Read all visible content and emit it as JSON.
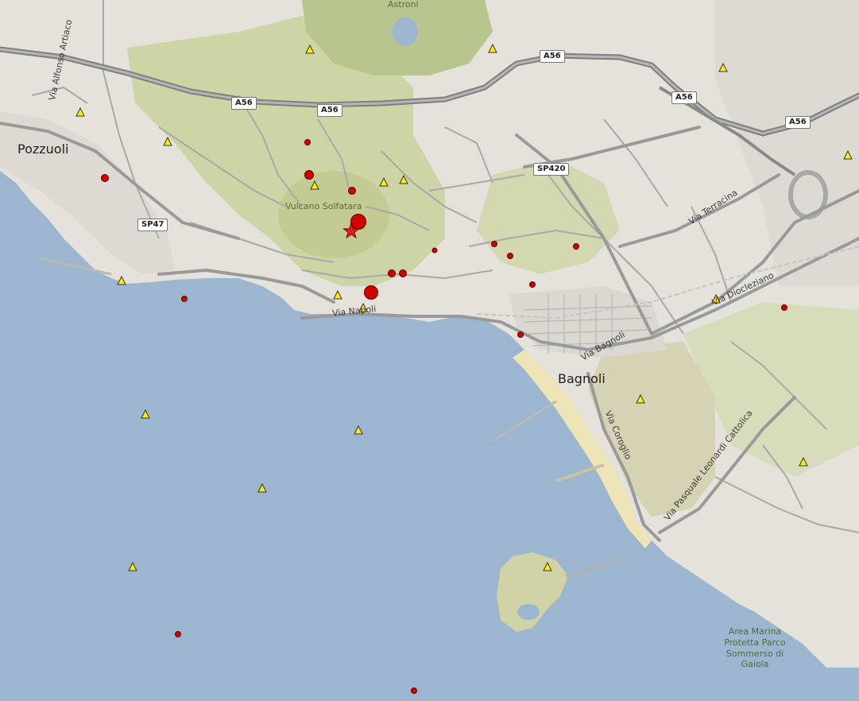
{
  "map": {
    "places": {
      "pozzuoli": "Pozzuoli",
      "bagnoli": "Bagnoli",
      "astroni": "Astroni",
      "solfatara": "Vulcano Solfatara",
      "marine_park": "Area Marina Protetta Parco Sommerso di Gaiola"
    },
    "roads": {
      "a56_1": "A56",
      "a56_2": "A56",
      "a56_3": "A56",
      "a56_4": "A56",
      "a56_5": "A56",
      "sp420": "SP420",
      "sp47": "SP47"
    },
    "streets": {
      "alfonso_artiaco": "Via Alfonso Artiaco",
      "napoli": "Via Napoli",
      "terracina": "Via Terracina",
      "diocleziano": "Via Diocleziano",
      "bagnoli": "Via Bagnoli",
      "coroglio": "Via Coroglio",
      "leonardi_cattolica": "Via Pasquale Leonardi Cattolica"
    },
    "colors": {
      "sea": "#9db6cf",
      "land": "#e6e4de",
      "vegetation": "#c9d3a4",
      "beach": "#ede5b8",
      "road": "#9d9d9d",
      "motorway": "#8a8a8a",
      "event_marker": "#d40000",
      "station_marker": "#ffee00",
      "epicenter_star": "#e02020"
    },
    "legend_icons": {
      "event": "red-circle-icon",
      "station": "yellow-triangle-icon",
      "epicenter": "red-star-icon"
    }
  }
}
